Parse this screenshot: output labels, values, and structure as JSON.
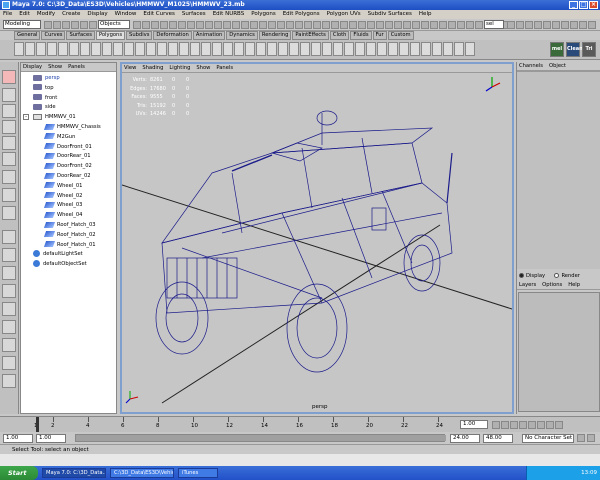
{
  "window": {
    "title": "Maya 7.0: C:\\3D_Data\\ES3D\\Vehicles\\HMMWV_M1025\\HMMWV_23.mb"
  },
  "menu": [
    "File",
    "Edit",
    "Modify",
    "Create",
    "Display",
    "Window",
    "Edit Curves",
    "Surfaces",
    "Edit NURBS",
    "Polygons",
    "Edit Polygons",
    "Polygon UVs",
    "Subdiv Surfaces",
    "Help"
  ],
  "status": {
    "mode": "Modeling",
    "select_mode": "Objects",
    "sel_label": "sel"
  },
  "shelf_tabs": [
    {
      "label": "General",
      "active": false
    },
    {
      "label": "Curves",
      "active": false
    },
    {
      "label": "Surfaces",
      "active": false
    },
    {
      "label": "Polygons",
      "active": true
    },
    {
      "label": "Subdivs",
      "active": false
    },
    {
      "label": "Deformation",
      "active": false
    },
    {
      "label": "Animation",
      "active": false
    },
    {
      "label": "Dynamics",
      "active": false
    },
    {
      "label": "Rendering",
      "active": false
    },
    {
      "label": "PaintEffects",
      "active": false
    },
    {
      "label": "Cloth",
      "active": false
    },
    {
      "label": "Fluids",
      "active": false
    },
    {
      "label": "Fur",
      "active": false
    },
    {
      "label": "Custom",
      "active": false
    }
  ],
  "shelf_right": {
    "mel_label": "mel",
    "clean_label": "Clean",
    "tri_label": "Tri"
  },
  "outliner": {
    "menu": [
      "Display",
      "Show",
      "Panels"
    ],
    "items": [
      {
        "label": "persp",
        "icon": "camera-icon",
        "indent": 0,
        "selected": true
      },
      {
        "label": "top",
        "icon": "camera-icon",
        "indent": 0
      },
      {
        "label": "front",
        "icon": "camera-icon",
        "indent": 0
      },
      {
        "label": "side",
        "icon": "camera-icon",
        "indent": 0
      },
      {
        "label": "HMMWV_01",
        "icon": "group-icon",
        "indent": 0,
        "expand": "-"
      },
      {
        "label": "HMMWV_Chassis",
        "icon": "mesh-icon",
        "indent": 1
      },
      {
        "label": "M2Gun",
        "icon": "mesh-icon",
        "indent": 1
      },
      {
        "label": "DoorFront_01",
        "icon": "mesh-icon",
        "indent": 1
      },
      {
        "label": "DoorRear_01",
        "icon": "mesh-icon",
        "indent": 1
      },
      {
        "label": "DoorFront_02",
        "icon": "mesh-icon",
        "indent": 1
      },
      {
        "label": "DoorRear_02",
        "icon": "mesh-icon",
        "indent": 1
      },
      {
        "label": "Wheel_01",
        "icon": "mesh-icon",
        "indent": 1
      },
      {
        "label": "Wheel_02",
        "icon": "mesh-icon",
        "indent": 1
      },
      {
        "label": "Wheel_03",
        "icon": "mesh-icon",
        "indent": 1
      },
      {
        "label": "Wheel_04",
        "icon": "mesh-icon",
        "indent": 1
      },
      {
        "label": "Roof_Hatch_03",
        "icon": "mesh-icon",
        "indent": 1
      },
      {
        "label": "Roof_Hatch_02",
        "icon": "mesh-icon",
        "indent": 1
      },
      {
        "label": "Roof_Hatch_01",
        "icon": "mesh-icon",
        "indent": 1
      },
      {
        "label": "defaultLightSet",
        "icon": "set-icon",
        "indent": 0
      },
      {
        "label": "defaultObjectSet",
        "icon": "set-icon",
        "indent": 0
      }
    ]
  },
  "viewport": {
    "menu": [
      "View",
      "Shading",
      "Lighting",
      "Show",
      "Panels"
    ],
    "hud": [
      {
        "label": "Verts:",
        "value": "8261",
        "a": "0",
        "b": "0"
      },
      {
        "label": "Edges:",
        "value": "17680",
        "a": "0",
        "b": "0"
      },
      {
        "label": "Faces:",
        "value": "9555",
        "a": "0",
        "b": "0"
      },
      {
        "label": "Tris:",
        "value": "15192",
        "a": "0",
        "b": "0"
      },
      {
        "label": "UVs:",
        "value": "14246",
        "a": "0",
        "b": "0"
      }
    ],
    "camera": "persp",
    "wire_color": "#1a1a8a",
    "bg_color": "#c6c6c6"
  },
  "channelbox": {
    "tabs": [
      "Channels",
      "Object"
    ]
  },
  "layers": {
    "display_label": "Display",
    "render_label": "Render",
    "menu": [
      "Layers",
      "Options",
      "Help"
    ]
  },
  "timeline": {
    "ticks": [
      "1",
      "2",
      "4",
      "6",
      "8",
      "10",
      "12",
      "14",
      "16",
      "18",
      "20",
      "22",
      "24"
    ],
    "current": "1.00"
  },
  "range": {
    "start": "1.00",
    "playback_start": "1.00",
    "playback_end": "24.00",
    "end": "48.00",
    "char_set": "No Character Set"
  },
  "help": "Select Tool: select an object",
  "taskbar": {
    "start": "Start",
    "items": [
      {
        "label": "Maya 7.0: C:\\3D_Data...",
        "active": true
      },
      {
        "label": "C:\\3D_Data\\ES3D\\Vehicl...",
        "active": false
      },
      {
        "label": "iTunes",
        "active": false
      }
    ],
    "clock": "13:09"
  }
}
